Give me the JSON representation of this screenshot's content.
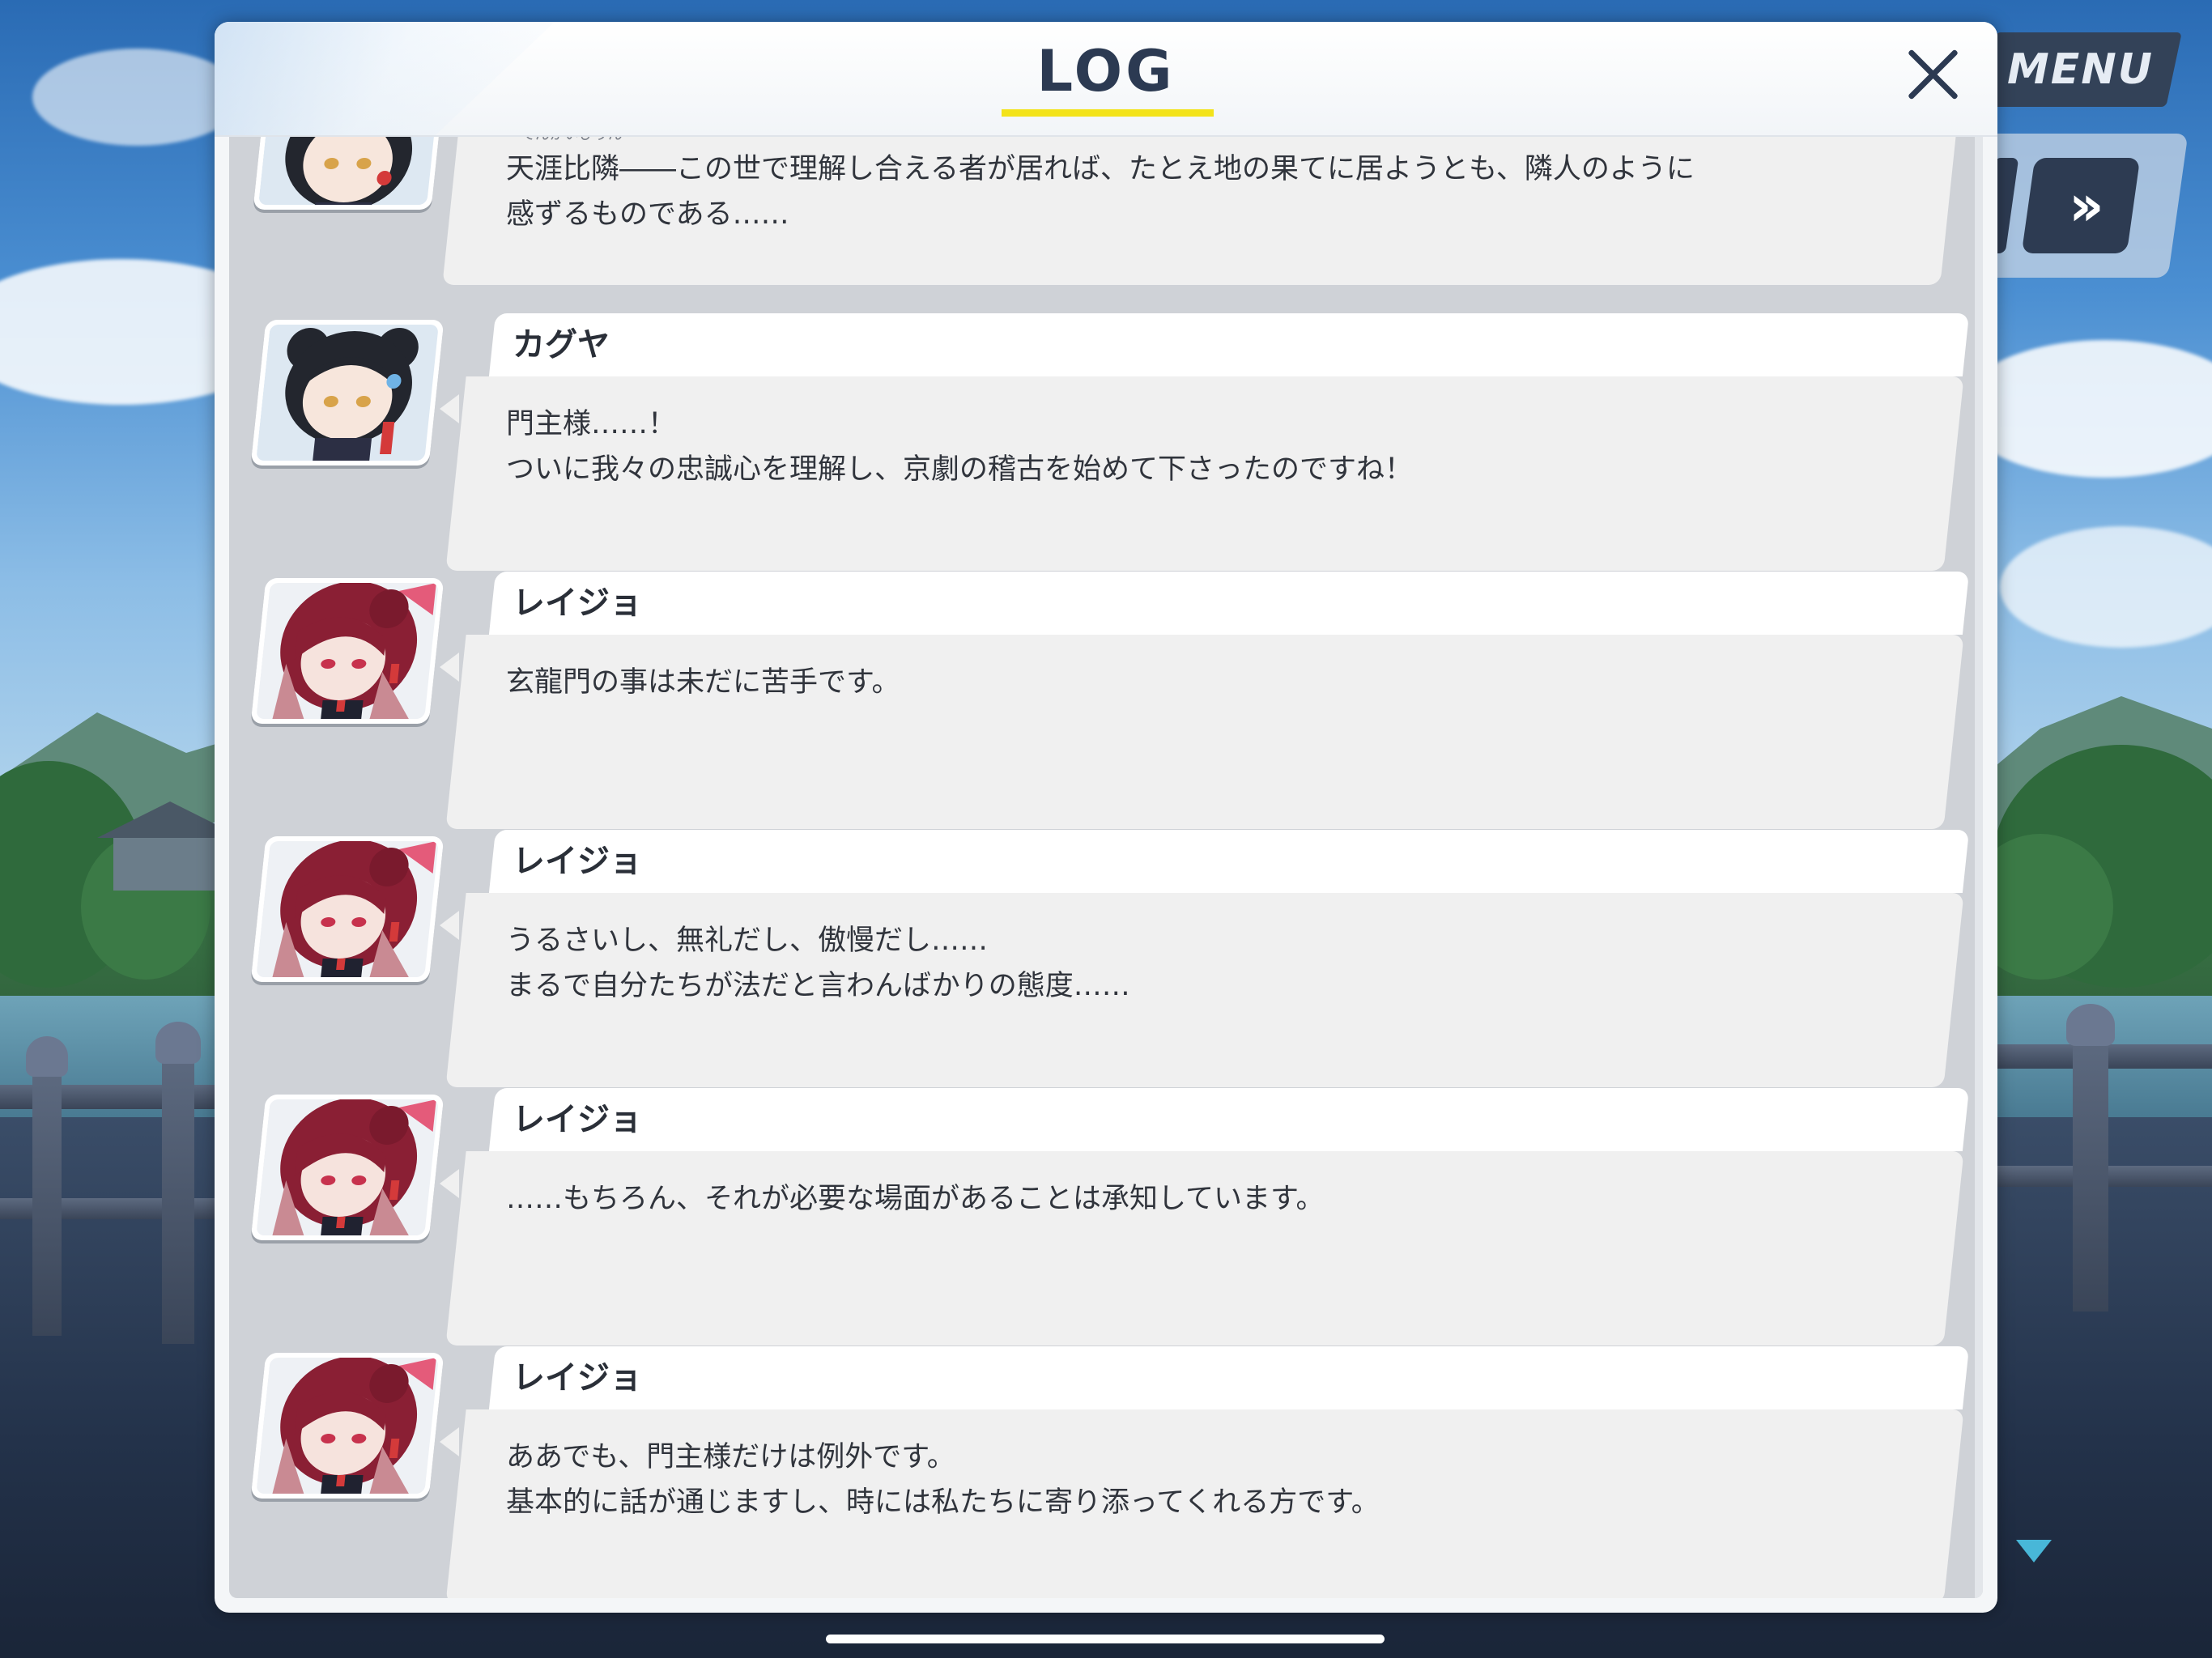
{
  "header": {
    "title": "LOG",
    "menu_label": "MENU",
    "fast_forward_label": "»"
  },
  "colors": {
    "title_underline": "#f3e31a",
    "title_text": "#2c3a52",
    "log_background": "#cfd2d7",
    "bubble": "#f0f0f0"
  },
  "icons": [
    "close-icon",
    "menu-button",
    "fast-forward-icon",
    "scroll-down-arrow-icon"
  ],
  "log": {
    "entries": [
      {
        "speaker": "",
        "portrait": "kaguya",
        "ruby": "てんがいひりん",
        "lines": [
          "天涯比隣――この世で理解し合える者が居れば、たとえ地の果てに居ようとも、隣人のように",
          "感ずるものである……"
        ]
      },
      {
        "speaker": "カグヤ",
        "portrait": "kaguya",
        "lines": [
          "門主様……！",
          "ついに我々の忠誠心を理解し、京劇の稽古を始めて下さったのですね！"
        ]
      },
      {
        "speaker": "レイジョ",
        "portrait": "reijo",
        "lines": [
          "玄龍門の事は未だに苦手です。"
        ]
      },
      {
        "speaker": "レイジョ",
        "portrait": "reijo",
        "lines": [
          "うるさいし、無礼だし、傲慢だし……",
          "まるで自分たちが法だと言わんばかりの態度……"
        ]
      },
      {
        "speaker": "レイジョ",
        "portrait": "reijo",
        "lines": [
          "……もちろん、それが必要な場面があることは承知しています。"
        ]
      },
      {
        "speaker": "レイジョ",
        "portrait": "reijo",
        "lines": [
          "ああでも、門主様だけは例外です。",
          "基本的に話が通じますし、時には私たちに寄り添ってくれる方です。"
        ]
      }
    ]
  }
}
